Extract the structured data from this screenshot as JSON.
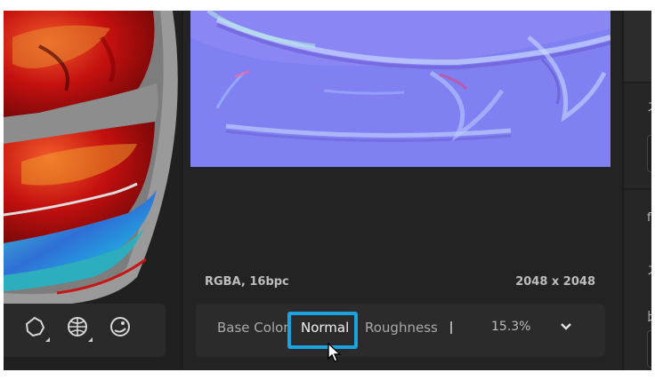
{
  "texture": {
    "format": "RGBA, 16bpc",
    "resolution": "2048 x 2048"
  },
  "channels": {
    "items": [
      "Base Color",
      "Normal",
      "Roughness"
    ],
    "selected": "Normal",
    "percent": "15.3%"
  },
  "viewport_tools": {
    "icons": [
      "lighting-icon",
      "environment-icon",
      "material-ball-icon"
    ]
  },
  "right_panel": {
    "glyphs": [
      "ス",
      "f",
      "ス",
      "比"
    ]
  },
  "colors": {
    "normal_map": "#7f7ff0",
    "highlight": "#1aa3e0",
    "panel": "#2b2b2b",
    "background": "#232323"
  }
}
